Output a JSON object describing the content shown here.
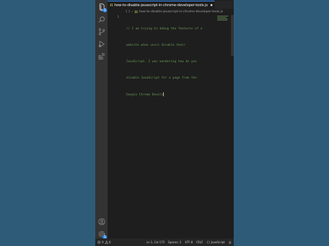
{
  "editor": {
    "active_tab": {
      "icon": "JS",
      "label": "how-to-disable-javascript-in-chrome-developer-tools.js",
      "dirty": true
    },
    "breadcrumb": {
      "icon": "JS",
      "segments": [
        "{ }",
        "JS"
      ],
      "file": "how-to-disable-javascript-in-chrome-developer-tools.js"
    },
    "line_number": "1",
    "code_lines": [
      "// I am trying to debug the features of a",
      "website when users disable their",
      "JavaScript. I was wondering how do you",
      "disable JavaScript for a page from the",
      "Google Chrome Develo"
    ]
  },
  "activity_bar": {
    "top": [
      {
        "name": "explorer-icon",
        "badge": "1"
      },
      {
        "name": "search-icon"
      },
      {
        "name": "source-control-icon"
      },
      {
        "name": "run-debug-icon"
      },
      {
        "name": "extensions-icon"
      }
    ],
    "bottom": [
      {
        "name": "account-icon"
      },
      {
        "name": "settings-gear-icon",
        "badge": "1"
      }
    ]
  },
  "status_bar": {
    "errors": "0",
    "warnings": "0",
    "position": "Ln 1, Col 175",
    "indent": "Spaces: 2",
    "encoding": "UTF-8",
    "eol": "CRLF",
    "language_braces": "{}",
    "language": "JavaScript"
  },
  "colors": {
    "background": "#2e5c78",
    "editor_bg": "#1e1e1e",
    "activity_bg": "#333333",
    "comment": "#6a9955",
    "accent": "#3794ff",
    "js_icon": "#cbcb41"
  }
}
